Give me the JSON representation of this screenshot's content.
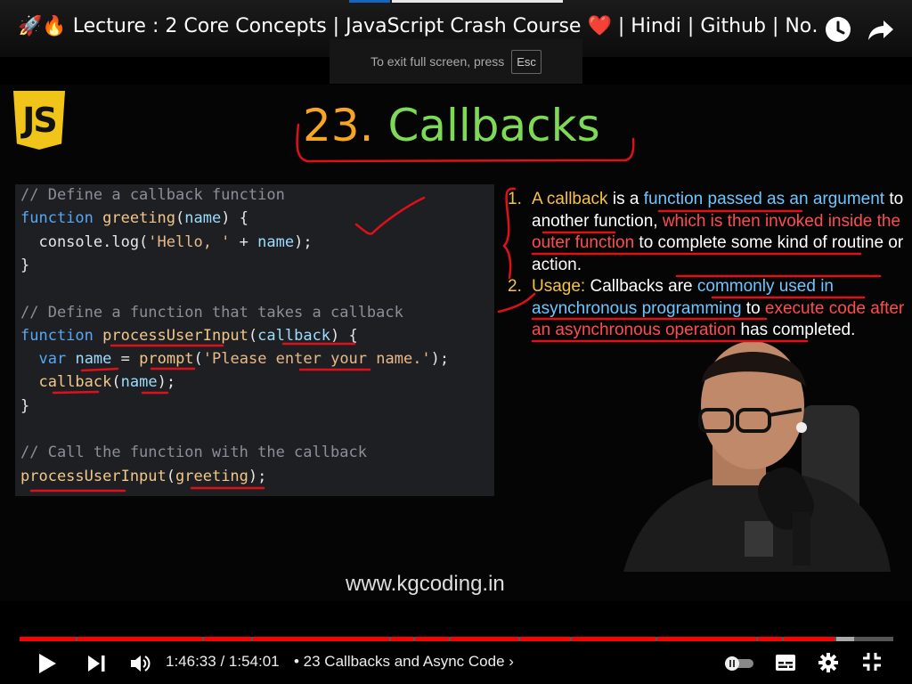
{
  "window": {
    "title": "🚀🔥 Lecture : 2 Core Concepts | JavaScript Crash Course ❤️ | Hindi | Github | No…",
    "exit_fullscreen_tip": "To exit full screen, press",
    "esc_key": "Esc"
  },
  "slide": {
    "logo_text": "JS",
    "heading_number": "23.",
    "heading_word": "Callbacks",
    "code_lines": [
      [
        {
          "t": "// Define a callback function",
          "c": "comment"
        }
      ],
      [
        {
          "t": "function",
          "c": "kw"
        },
        {
          "t": " ",
          "c": "plain"
        },
        {
          "t": "greeting",
          "c": "fn"
        },
        {
          "t": "(",
          "c": "plain"
        },
        {
          "t": "name",
          "c": "var"
        },
        {
          "t": ") {",
          "c": "plain"
        }
      ],
      [
        {
          "t": "  console.log(",
          "c": "plain"
        },
        {
          "t": "'Hello, '",
          "c": "str"
        },
        {
          "t": " + ",
          "c": "plain"
        },
        {
          "t": "name",
          "c": "var"
        },
        {
          "t": ");",
          "c": "plain"
        }
      ],
      [
        {
          "t": "}",
          "c": "plain"
        }
      ],
      [],
      [
        {
          "t": "// Define a function that takes a callback",
          "c": "comment"
        }
      ],
      [
        {
          "t": "function",
          "c": "kw"
        },
        {
          "t": " ",
          "c": "plain"
        },
        {
          "t": "processUserInput",
          "c": "fn"
        },
        {
          "t": "(",
          "c": "plain"
        },
        {
          "t": "callback",
          "c": "var"
        },
        {
          "t": ") {",
          "c": "plain"
        }
      ],
      [
        {
          "t": "  ",
          "c": "plain"
        },
        {
          "t": "var",
          "c": "kw"
        },
        {
          "t": " ",
          "c": "plain"
        },
        {
          "t": "name",
          "c": "var"
        },
        {
          "t": " = ",
          "c": "plain"
        },
        {
          "t": "prompt",
          "c": "fn"
        },
        {
          "t": "(",
          "c": "plain"
        },
        {
          "t": "'Please enter your name.'",
          "c": "str"
        },
        {
          "t": ");",
          "c": "plain"
        }
      ],
      [
        {
          "t": "  ",
          "c": "plain"
        },
        {
          "t": "callback",
          "c": "fn"
        },
        {
          "t": "(",
          "c": "plain"
        },
        {
          "t": "name",
          "c": "var"
        },
        {
          "t": ");",
          "c": "plain"
        }
      ],
      [
        {
          "t": "}",
          "c": "plain"
        }
      ],
      [],
      [
        {
          "t": "// Call the function with the callback",
          "c": "comment"
        }
      ],
      [
        {
          "t": "processUserInput",
          "c": "fn"
        },
        {
          "t": "(",
          "c": "plain"
        },
        {
          "t": "greeting",
          "c": "fn"
        },
        {
          "t": ");",
          "c": "plain"
        }
      ]
    ],
    "notes": [
      {
        "marker": "1.",
        "segments": [
          {
            "t": "A ",
            "c": "yellow"
          },
          {
            "t": "callback",
            "c": "yellow"
          },
          {
            "t": " is a ",
            "c": "white"
          },
          {
            "t": "function passed as an argument",
            "c": "blue"
          },
          {
            "t": " to another function, ",
            "c": "white"
          },
          {
            "t": "which is then invoked inside the outer function",
            "c": "red"
          },
          {
            "t": " to complete some kind of routine or action.",
            "c": "white"
          }
        ]
      },
      {
        "marker": "2.",
        "segments": [
          {
            "t": "Usage:",
            "c": "yellow"
          },
          {
            "t": " Callbacks are ",
            "c": "white"
          },
          {
            "t": "commonly used in asynchronous programming",
            "c": "blue"
          },
          {
            "t": " to ",
            "c": "white"
          },
          {
            "t": "execute code after an asynchronous operation",
            "c": "red"
          },
          {
            "t": " has completed.",
            "c": "white"
          }
        ]
      }
    ],
    "website": "www.kgcoding.in"
  },
  "player": {
    "current_time": "1:46:33",
    "duration": "1:54:01",
    "time_separator": " / ",
    "chapter": "• 23 Callbacks and Async Code",
    "chapter_chevron": "›",
    "progress_fraction": 0.9345,
    "icons": {
      "play": "play-icon",
      "next": "next-icon",
      "volume": "volume-icon",
      "autoplay": "autoplay-toggle-icon",
      "subtitles": "subtitles-icon",
      "settings": "gear-icon",
      "exit_fullscreen": "exit-fullscreen-icon",
      "watch_later": "clock-icon",
      "share": "share-icon"
    }
  },
  "colors": {
    "progress_played": "#ff0000",
    "progress_buffered": "#aaaaaa",
    "progress_track": "#555555",
    "annotation_red": "#e0101a",
    "heading_orange": "#f6a623",
    "heading_green": "#7ed957"
  }
}
